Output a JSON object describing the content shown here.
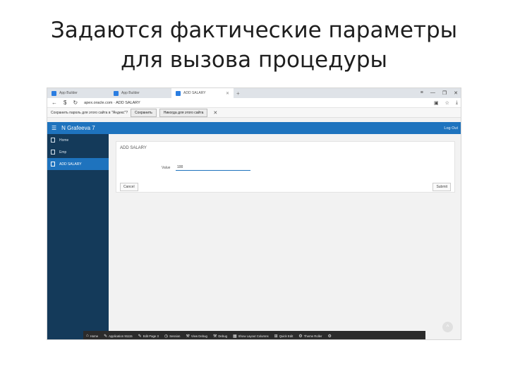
{
  "slide": {
    "title_line1": "Задаются фактические параметры",
    "title_line2": "для вызова процедуры"
  },
  "browser": {
    "tabs": [
      {
        "label": "App Builder",
        "active": false
      },
      {
        "label": "App Builder",
        "active": false
      },
      {
        "label": "ADD SALARY",
        "active": true
      }
    ],
    "newtab_glyph": "+",
    "window_controls": [
      "≡",
      "—",
      "❐",
      "✕"
    ],
    "back_glyph": "←",
    "forward_glyph": "$",
    "reload_glyph": "↻",
    "url": "apex.oracle.com · ADD SALARY",
    "addr_icons": [
      "▣",
      "☆",
      "⤓"
    ]
  },
  "password_bar": {
    "message": "Сохранить пароль для этого сайта в \"Яндекс\"?",
    "save_label": "Сохранить",
    "never_label": "Никогда для этого сайта",
    "close_glyph": "✕"
  },
  "app": {
    "menu_glyph": "☰",
    "name": "N Grafeeva 7",
    "logout_label": "Log Out",
    "sidebar": [
      {
        "label": "Home",
        "active": false
      },
      {
        "label": "Emp",
        "active": false
      },
      {
        "label": "ADD SALARY",
        "active": true
      }
    ],
    "region_title": "ADD SALARY",
    "value_label": "Value",
    "value": "100",
    "cancel_label": "Cancel",
    "submit_label": "Submit",
    "scroll_top_glyph": "^"
  },
  "devbar": [
    {
      "icon": "⌂",
      "label": "Home"
    },
    {
      "icon": "✎",
      "label": "Application 91115"
    },
    {
      "icon": "✎",
      "label": "Edit Page 3"
    },
    {
      "icon": "◷",
      "label": "Session"
    },
    {
      "icon": "⚒",
      "label": "View Debug"
    },
    {
      "icon": "⚒",
      "label": "Debug"
    },
    {
      "icon": "▦",
      "label": "Show Layout Columns"
    },
    {
      "icon": "⊞",
      "label": "Quick Edit"
    },
    {
      "icon": "⚙",
      "label": "Theme Roller"
    },
    {
      "icon": "⚙",
      "label": ""
    }
  ],
  "colors": {
    "accent": "#1e73be",
    "sidebar_bg": "#143a5a",
    "devbar_bg": "#2b2b2b"
  }
}
